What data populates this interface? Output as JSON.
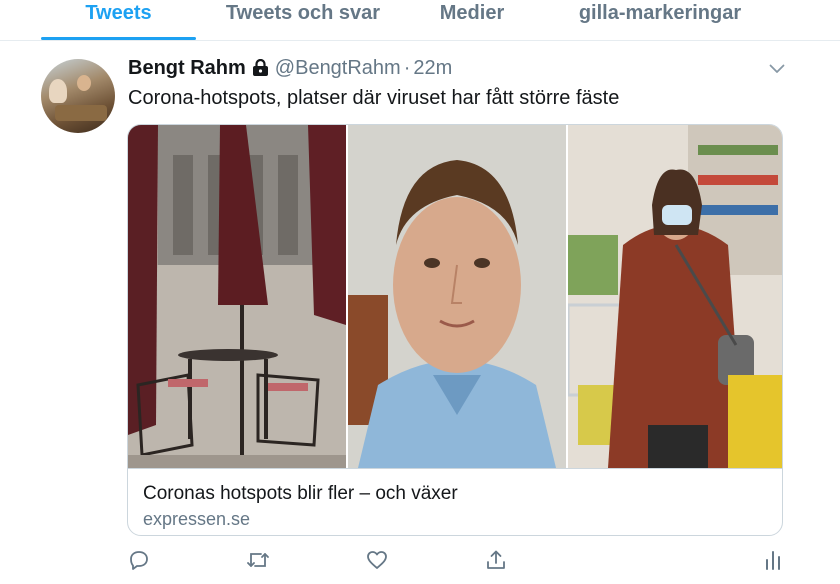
{
  "tabs": [
    {
      "label": "Tweets",
      "active": true
    },
    {
      "label": "Tweets och svar",
      "active": false
    },
    {
      "label": "Medier",
      "active": false
    },
    {
      "label": "gilla-markeringar",
      "active": false
    }
  ],
  "tweet": {
    "author_name": "Bengt Rahm",
    "protected_icon": "lock-icon",
    "handle": "@BengtRahm",
    "separator": "·",
    "time": "22m",
    "text": "Corona-hotspots, platser där viruset har fått större fäste",
    "card": {
      "title": "Coronas hotspots blir fler – och växer",
      "domain": "expressen.se"
    },
    "actions": [
      "reply-icon",
      "retweet-icon",
      "like-icon",
      "share-icon",
      "analytics-icon"
    ]
  },
  "colors": {
    "accent": "#1da1f2",
    "secondary_text": "#657786",
    "primary_text": "#14171a",
    "border": "#ccd6dd"
  }
}
